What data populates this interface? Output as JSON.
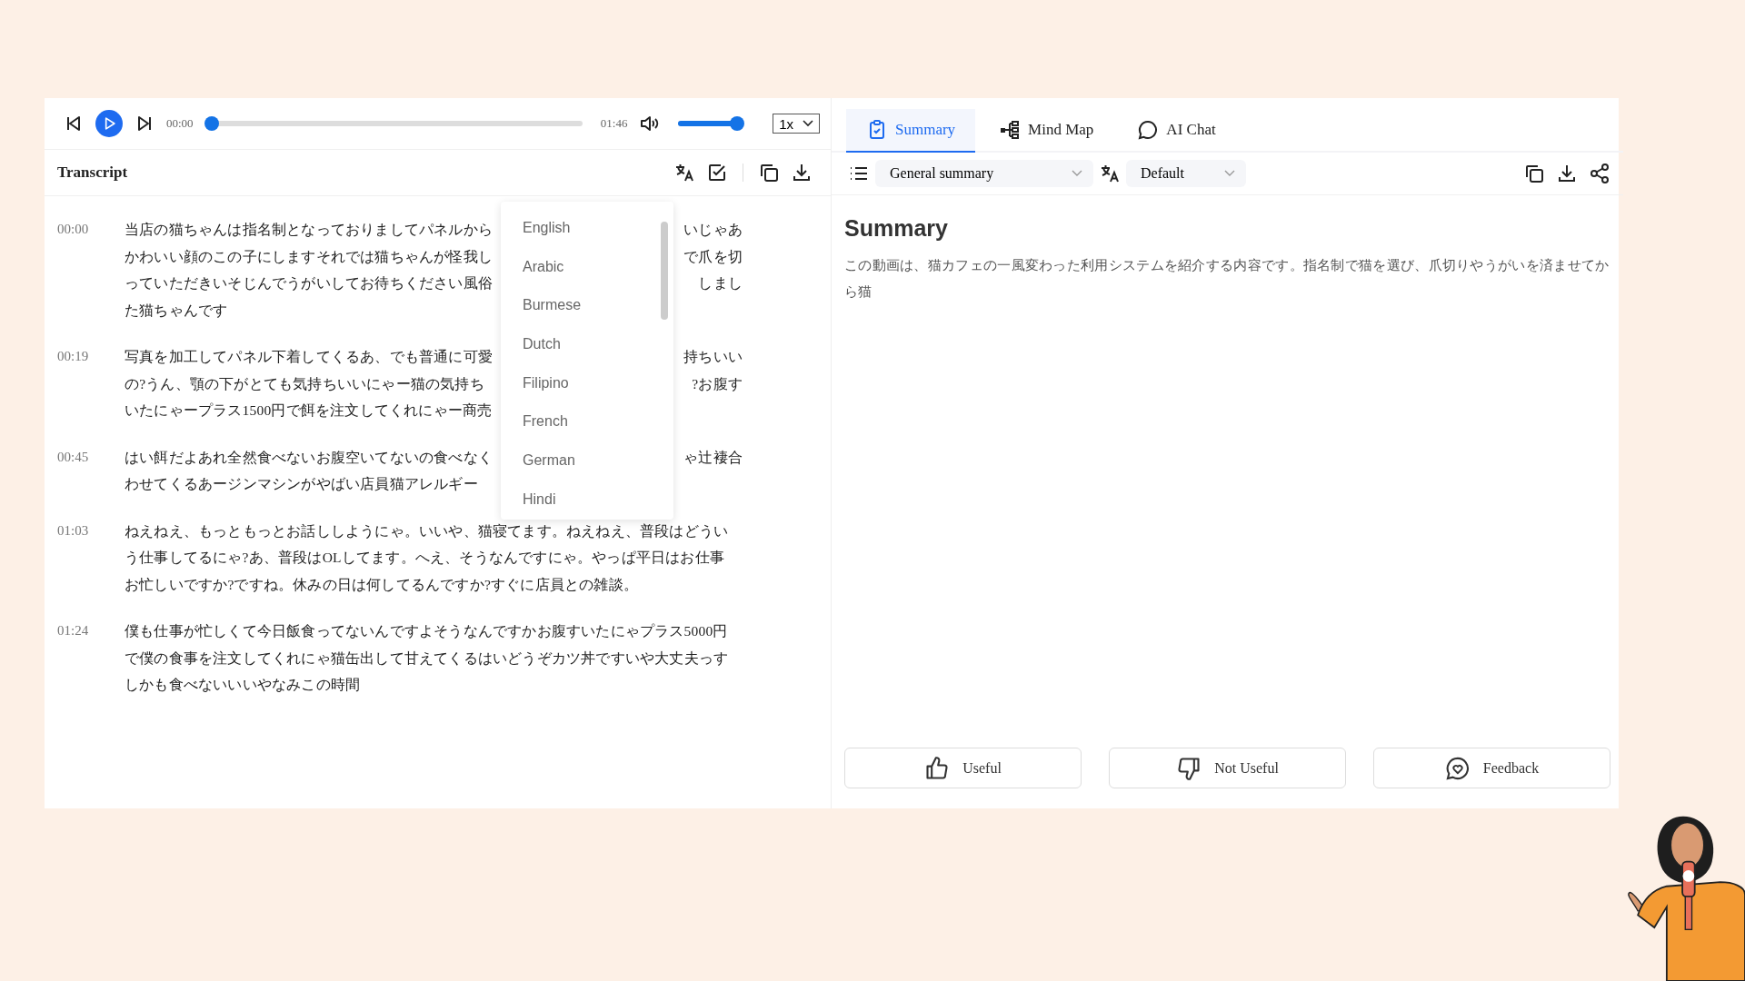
{
  "player": {
    "current_time": "00:00",
    "duration": "01:46",
    "progress": {
      "level": 0
    },
    "volume": {
      "level": 0.9
    },
    "speed": "1x"
  },
  "transcript": {
    "title": "Transcript",
    "segments": [
      {
        "time": "00:00",
        "lines": [
          [
            "当店の猫ちゃんは指名制となっておりましてパネルから",
            "いじゃあ"
          ],
          [
            "かわいい顔のこの子にしますそれでは猫ちゃんが怪我し",
            "で爪を切"
          ],
          [
            "っていただきいそじんでうがいしてお待ちください風俗",
            "しまし"
          ],
          [
            "た猫ちゃんです"
          ]
        ]
      },
      {
        "time": "00:19",
        "lines": [
          [
            "写真を加工してパネル下着してくるあ、でも普通に可愛",
            "持ちいい"
          ],
          [
            "の?うん、顎の下がとても気持ちいいにゃー猫の気持ち",
            "?お腹す"
          ],
          [
            "いたにゃープラス1500円で餌を注文してくれにゃー商売"
          ]
        ]
      },
      {
        "time": "00:45",
        "lines": [
          [
            "はい餌だよあれ全然食べないお腹空いてないの食べなく",
            "ゃ辻褄合"
          ],
          [
            "わせてくるあージンマシンがやばい店員猫アレルギー"
          ]
        ]
      },
      {
        "time": "01:03",
        "lines": [
          [
            "ねえねえ、もっともっとお話ししようにゃ。いいや、猫寝てます。ねえねえ、普段はどうい"
          ],
          [
            "う仕事してるにゃ?あ、普段はOLしてます。へえ、そうなんですにゃ。やっぱ平日はお仕事"
          ],
          [
            "お忙しいですか?ですね。休みの日は何してるんですか?すぐに店員との雑談。"
          ]
        ]
      },
      {
        "time": "01:24",
        "lines": [
          [
            "僕も仕事が忙しくて今日飯食ってないんですよそうなんですかお腹すいたにゃプラス5000円"
          ],
          [
            "で僕の食事を注文してくれにゃ猫缶出して甘えてくるはいどうぞカツ丼ですいや大丈夫っす"
          ],
          [
            "しかも食べないいいやなみこの時間"
          ]
        ]
      }
    ]
  },
  "language_menu": {
    "options": [
      "English",
      "Arabic",
      "Burmese",
      "Dutch",
      "Filipino",
      "French",
      "German",
      "Hindi"
    ]
  },
  "tabs": [
    {
      "label": "Summary",
      "kind": "summary",
      "selected": true
    },
    {
      "label": "Mind Map",
      "kind": "mindmap",
      "selected": false
    },
    {
      "label": "AI Chat",
      "kind": "chat",
      "selected": false
    }
  ],
  "summary_toolbar": {
    "template": "General summary",
    "language": "Default"
  },
  "summary": {
    "heading": "Summary",
    "text": "この動画は、猫カフェの一風変わった利用システムを紹介する内容です。指名制で猫を選び、爪切りやうがいを済ませてから猫"
  },
  "feedback_buttons": [
    {
      "label": "Useful",
      "kind": "up"
    },
    {
      "label": "Not Useful",
      "kind": "down"
    },
    {
      "label": "Feedback",
      "kind": "heart"
    }
  ]
}
